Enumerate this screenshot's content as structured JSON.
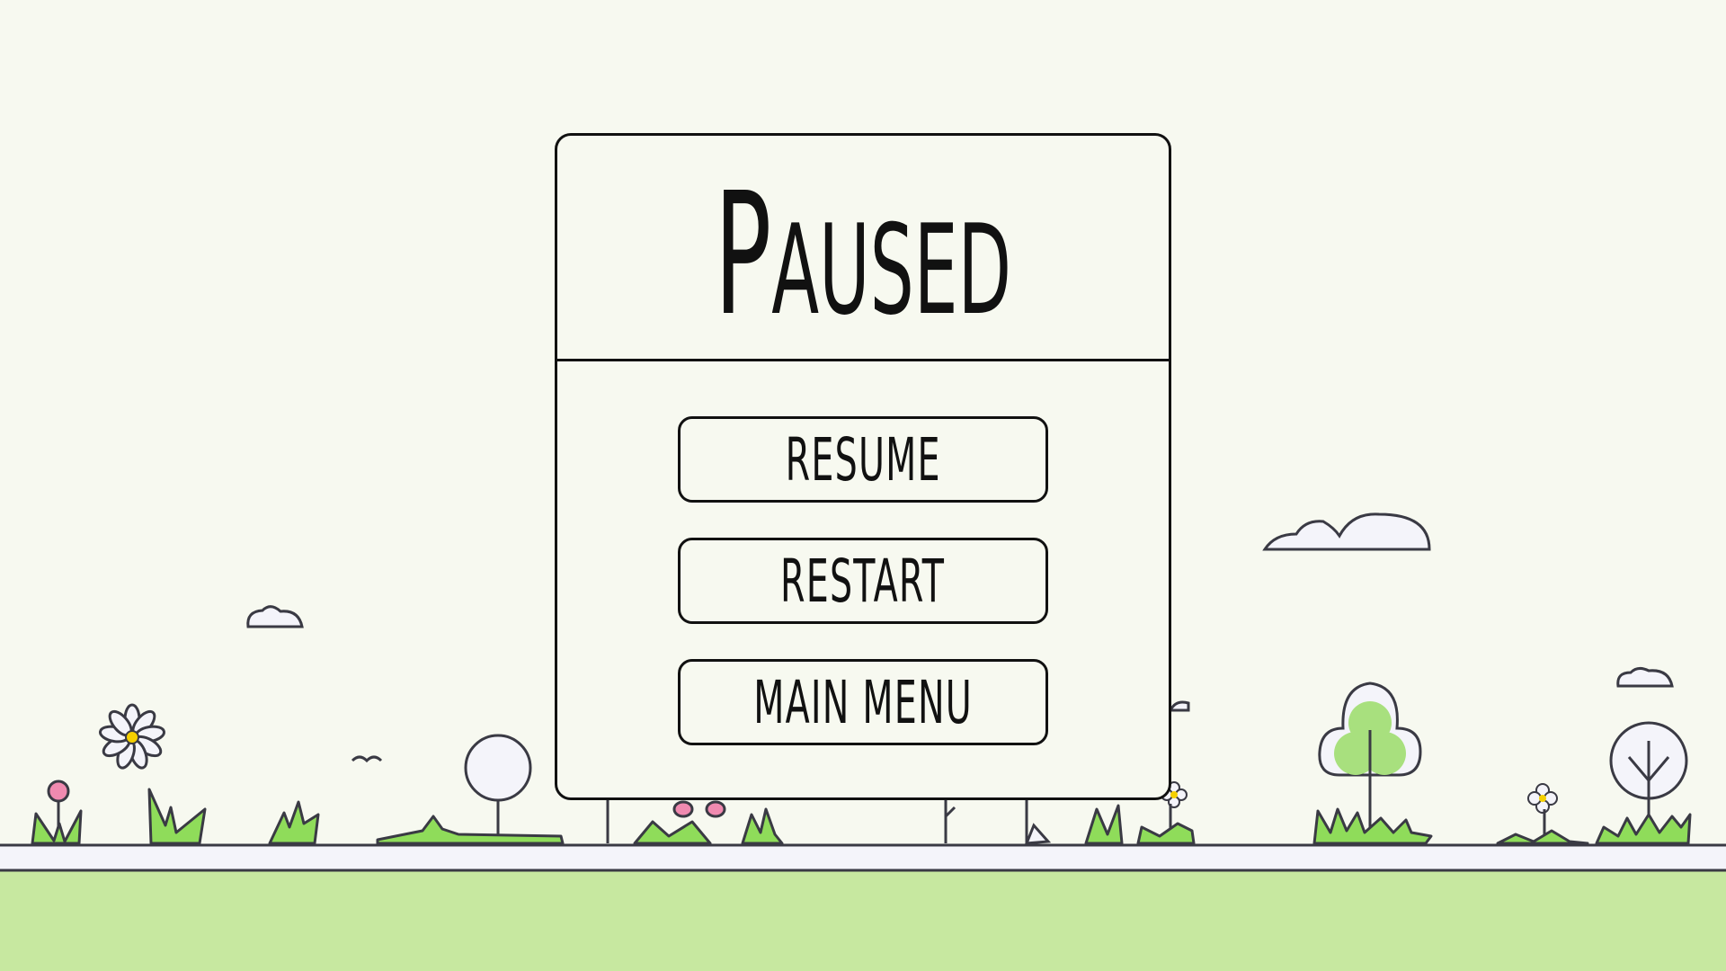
{
  "pause_menu": {
    "title_first": "P",
    "title_rest": "AUSED",
    "buttons": {
      "resume": "RESUME",
      "restart": "RESTART",
      "main_menu": "MAIN MENU"
    }
  },
  "colors": {
    "background": "#f7f9f0",
    "ground": "#c7e8a0",
    "grass": "#8fdc5a",
    "outline": "#3a3a44",
    "flower_pink": "#f08ab0",
    "flower_white": "#f4f4fa",
    "flower_center": "#f5d000"
  }
}
